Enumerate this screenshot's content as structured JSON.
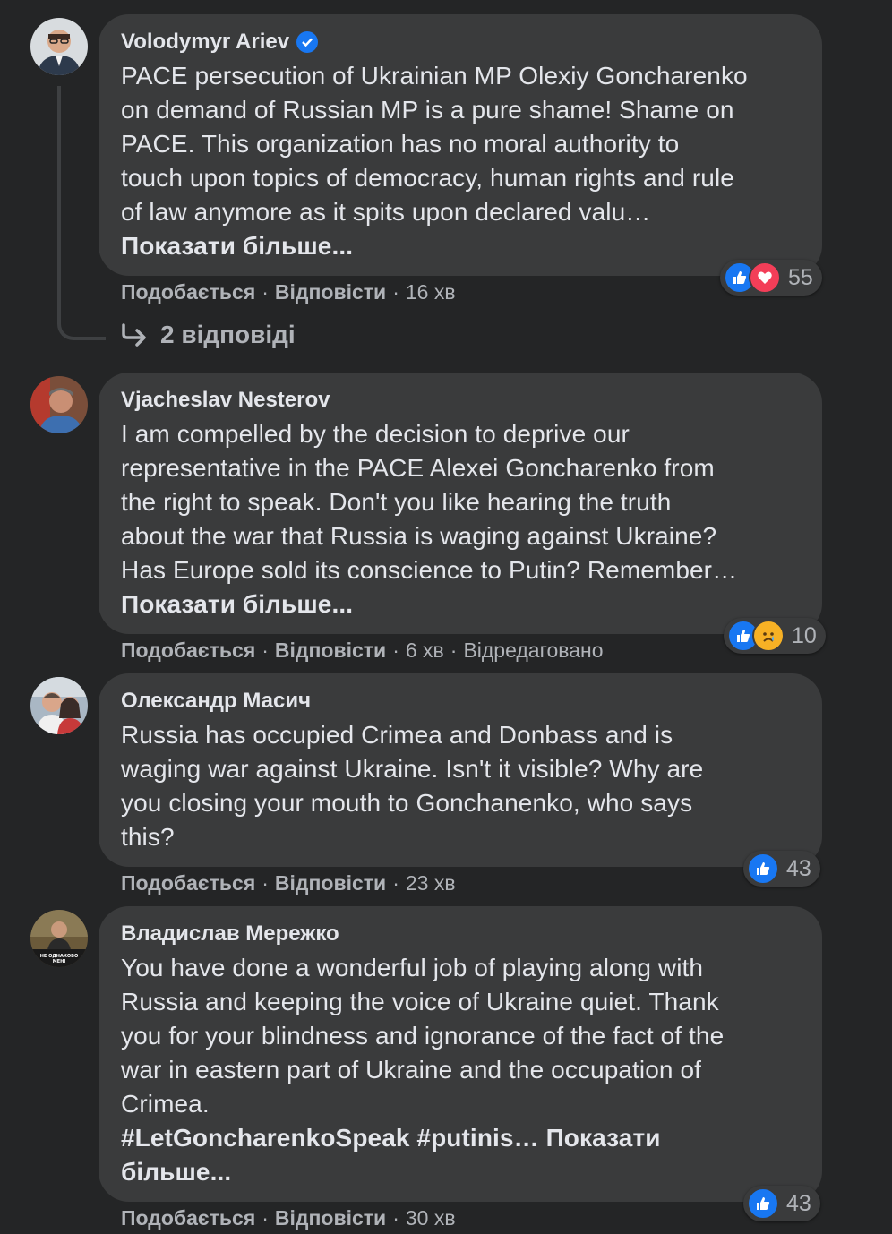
{
  "comments": [
    {
      "author": "Volodymyr Ariev",
      "verified": true,
      "lines": [
        "PACE persecution of Ukrainian MP Olexiy Goncharenko",
        "on demand of Russian MP is a pure shame! Shame on",
        "PACE. This organization has no moral authority to",
        "touch upon topics of democracy, human rights and rule",
        "of law anymore as it spits upon declared valu…"
      ],
      "more": "Показати більше...",
      "like_label": "Подобається",
      "reply_label": "Відповісти",
      "time": "16 хв",
      "edited": "",
      "reaction_count": "55",
      "reactions": [
        "like",
        "love"
      ],
      "replies_label": "2 відповіді"
    },
    {
      "author": "Vjacheslav Nesterov",
      "lines": [
        "I am compelled by the decision to deprive our",
        "representative in the PACE Alexei Goncharenko from",
        "the right to speak. Don't you like hearing the truth",
        "about the war that Russia is waging against Ukraine?",
        "Has Europe sold its conscience to Putin? Remember…"
      ],
      "more": "Показати більше...",
      "like_label": "Подобається",
      "reply_label": "Відповісти",
      "time": "6 хв",
      "edited": "Відредаговано",
      "reaction_count": "10",
      "reactions": [
        "like",
        "sad"
      ]
    },
    {
      "author": "Олександр Масич",
      "lines": [
        "Russia has occupied Crimea and Donbass and is",
        "waging war against Ukraine. Isn't it visible? Why are",
        "you closing your mouth to Gonchanenko, who says",
        "this?"
      ],
      "like_label": "Подобається",
      "reply_label": "Відповісти",
      "time": "23 хв",
      "reaction_count": "43",
      "reactions": [
        "like"
      ]
    },
    {
      "author": "Владислав Мережко",
      "lines": [
        "You have done a wonderful job of playing along with",
        "Russia and keeping the voice of Ukraine quiet. Thank",
        "you for your blindness and ignorance of the fact of the",
        "war in eastern part of Ukraine and the occupation of",
        "Crimea."
      ],
      "hashtags": "#LetGoncharenkoSpeak #putinis…",
      "more_inline": "Показати",
      "more_tail": "більше...",
      "avatar_caption": "НЕ ОДНАКОВО МЕНІ",
      "like_label": "Подобається",
      "reply_label": "Відповісти",
      "time": "30 хв",
      "reaction_count": "43",
      "reactions": [
        "like"
      ]
    }
  ],
  "colors": {
    "background": "#242526",
    "bubble": "#3a3b3c",
    "text": "#e4e6eb",
    "secondary": "#b0b3b8",
    "like_blue": "#1877f2",
    "love_red": "#f33e58",
    "sad_yellow": "#f7b125"
  }
}
